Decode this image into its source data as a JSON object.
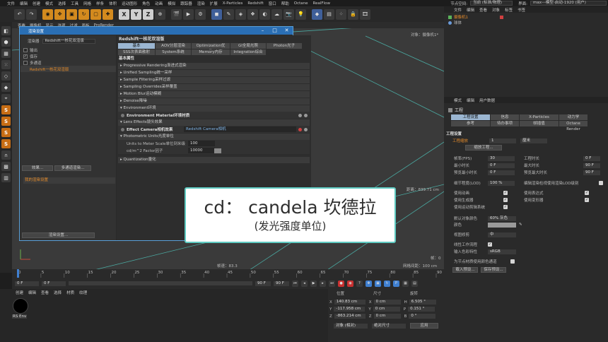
{
  "menubar": {
    "items": [
      "文件",
      "编辑",
      "创建",
      "模式",
      "选择",
      "工具",
      "网格",
      "样条",
      "体积",
      "运动图形",
      "角色",
      "动画",
      "模拟",
      "跟踪器",
      "渲染",
      "扩展",
      "X-Particles",
      "Redshift",
      "窗口",
      "帮助",
      "Octane",
      "RealFlow"
    ],
    "node_space_label": "节点空间:",
    "node_space_value": "当前 (标准/物理)",
    "interface_label": "界面:",
    "interface_value": "max---模型-启动-1920 (用户)"
  },
  "toolbar": {
    "axis": [
      "X",
      "Y",
      "Z"
    ]
  },
  "viewport": {
    "menu": [
      "查看",
      "摄像机",
      "显示",
      "选项",
      "过滤",
      "面板",
      "ProRender"
    ],
    "camera_label": "对象：摄像机1*",
    "distance": "距离：839.71 cm",
    "frame": "帧：0",
    "fps": "帧速：83.3",
    "grid": "网格间距：100 cm"
  },
  "render_window": {
    "title": "渲染设置",
    "renderer_label": "渲染器",
    "renderer_value": "Redshift一核花双渲版",
    "left_items": [
      {
        "label": "输出",
        "checked": false
      },
      {
        "label": "保存",
        "checked": true
      },
      {
        "label": "多通道",
        "checked": false
      },
      {
        "label": "Redshift一核花双渲版",
        "checked": false
      }
    ],
    "effects_btn": "效果...",
    "multipass_btn": "多通道渲染...",
    "my_settings": "我的渲染设置",
    "render_settings_btn": "渲染设置...",
    "right_title": "Redshift一核花双渲版",
    "tabs_row1": [
      "基本",
      "AOV分层渲染",
      "Optimization优化",
      "GI全局光照",
      "Photon光子"
    ],
    "tabs_row2": [
      "SSS次表面散射",
      "System系统",
      "Memory内存",
      "Integration综合"
    ],
    "section_title": "基本属性",
    "sections": [
      "Progressive Rendering渐进式渲染",
      "Unified Sampling统一采样",
      "Sample Filtering采样过滤",
      "Sampling Overrides采样覆盖",
      "Motion Blur运动模糊",
      "Denoise降噪",
      "Environment环境"
    ],
    "env_material": "Environment Material环境材质",
    "lens_effects": "Lens Effects镜头效果",
    "effect_camera_label": "Effect Camera相机效果",
    "effect_camera_value": "Redshift Camera相机",
    "photometric": "Photometric Units光度单位",
    "units_label": "Units to Meter Scale单位到米级",
    "units_value": "100",
    "cdm_label": "cd/m^2 Factor因子",
    "cdm_value": "10000",
    "quantization": "Quantization量化"
  },
  "overlay": {
    "line1": "cd： candela 坎德拉",
    "line2": "(发光强度单位)"
  },
  "objects_panel": {
    "menu": [
      "文件",
      "编辑",
      "查看",
      "对象",
      "标签",
      "书签"
    ],
    "items": [
      "摄像机1",
      "球体"
    ]
  },
  "attributes_panel": {
    "menu": [
      "模式",
      "编辑",
      "用户数据"
    ],
    "title": "工程",
    "tabs_row1": [
      "工程设置",
      "信息",
      "X-Particles",
      "动力学"
    ],
    "tabs_row2": [
      "参考",
      "待办事项",
      "帧插值",
      "Octane Render"
    ],
    "section": "工程设置",
    "scale_label": "工程缩放",
    "scale_value": "1",
    "scale_unit": "厘米",
    "scale_btn": "缩放工程...",
    "fields_left": [
      {
        "label": "帧率(FPS)",
        "value": "30"
      },
      {
        "label": "最小时长",
        "value": "0 F"
      },
      {
        "label": "预览最小时长",
        "value": "0 F"
      },
      {
        "label": "细节程度(LOD)",
        "value": "100 %"
      }
    ],
    "fields_right": [
      {
        "label": "工程时长",
        "value": "0 F"
      },
      {
        "label": "最大时长",
        "value": "90 F"
      },
      {
        "label": "预览最大时长",
        "value": "90 F"
      },
      {
        "label": "编辑渲染检视使用渲染LOD级别",
        "value": ""
      }
    ],
    "checks_left": [
      "使用动画",
      "使用生成器",
      "使用运动剪辑系统"
    ],
    "checks_right": [
      "使用表达式",
      "使用变形器"
    ],
    "default_color_label": "默认对象颜色",
    "default_color_value": "60% 灰色",
    "color_label": "颜色",
    "view_clip_label": "视图修剪",
    "view_clip_value": "中",
    "linear_label": "线性工作流程",
    "input_color_label": "输入色彩特性",
    "input_color_value": "sRGB",
    "node_color_label": "为节点材质使用颜色通道",
    "load_preset": "载入预设...",
    "save_preset": "保存预设..."
  },
  "timeline": {
    "ticks": [
      "0",
      "5",
      "10",
      "15",
      "20",
      "25",
      "30",
      "35",
      "40",
      "45",
      "50",
      "55",
      "60",
      "65",
      "70",
      "75",
      "80",
      "85",
      "90"
    ],
    "start": "0 F",
    "start2": "0 F",
    "end": "90 F",
    "end2": "90 F"
  },
  "materials": {
    "menu": [
      "创建",
      "编辑",
      "查看",
      "选择",
      "材质",
      "纹理"
    ],
    "mat_name": "RS Env"
  },
  "coords": {
    "headers": [
      "位置",
      "尺寸",
      "旋转"
    ],
    "rows": [
      {
        "axis": "X",
        "pos": "140.83 cm",
        "size": "0 cm",
        "rot_axis": "H",
        "rot": "6.505 °"
      },
      {
        "axis": "Y",
        "pos": "-117.958 cm",
        "size": "0 cm",
        "rot_axis": "P",
        "rot": "0.151 °"
      },
      {
        "axis": "Z",
        "pos": "-863.214 cm",
        "size": "0 cm",
        "rot_axis": "B",
        "rot": "0 °"
      }
    ],
    "mode1": "对象 (相对)",
    "mode2": "绝对尺寸",
    "apply": "应用"
  }
}
